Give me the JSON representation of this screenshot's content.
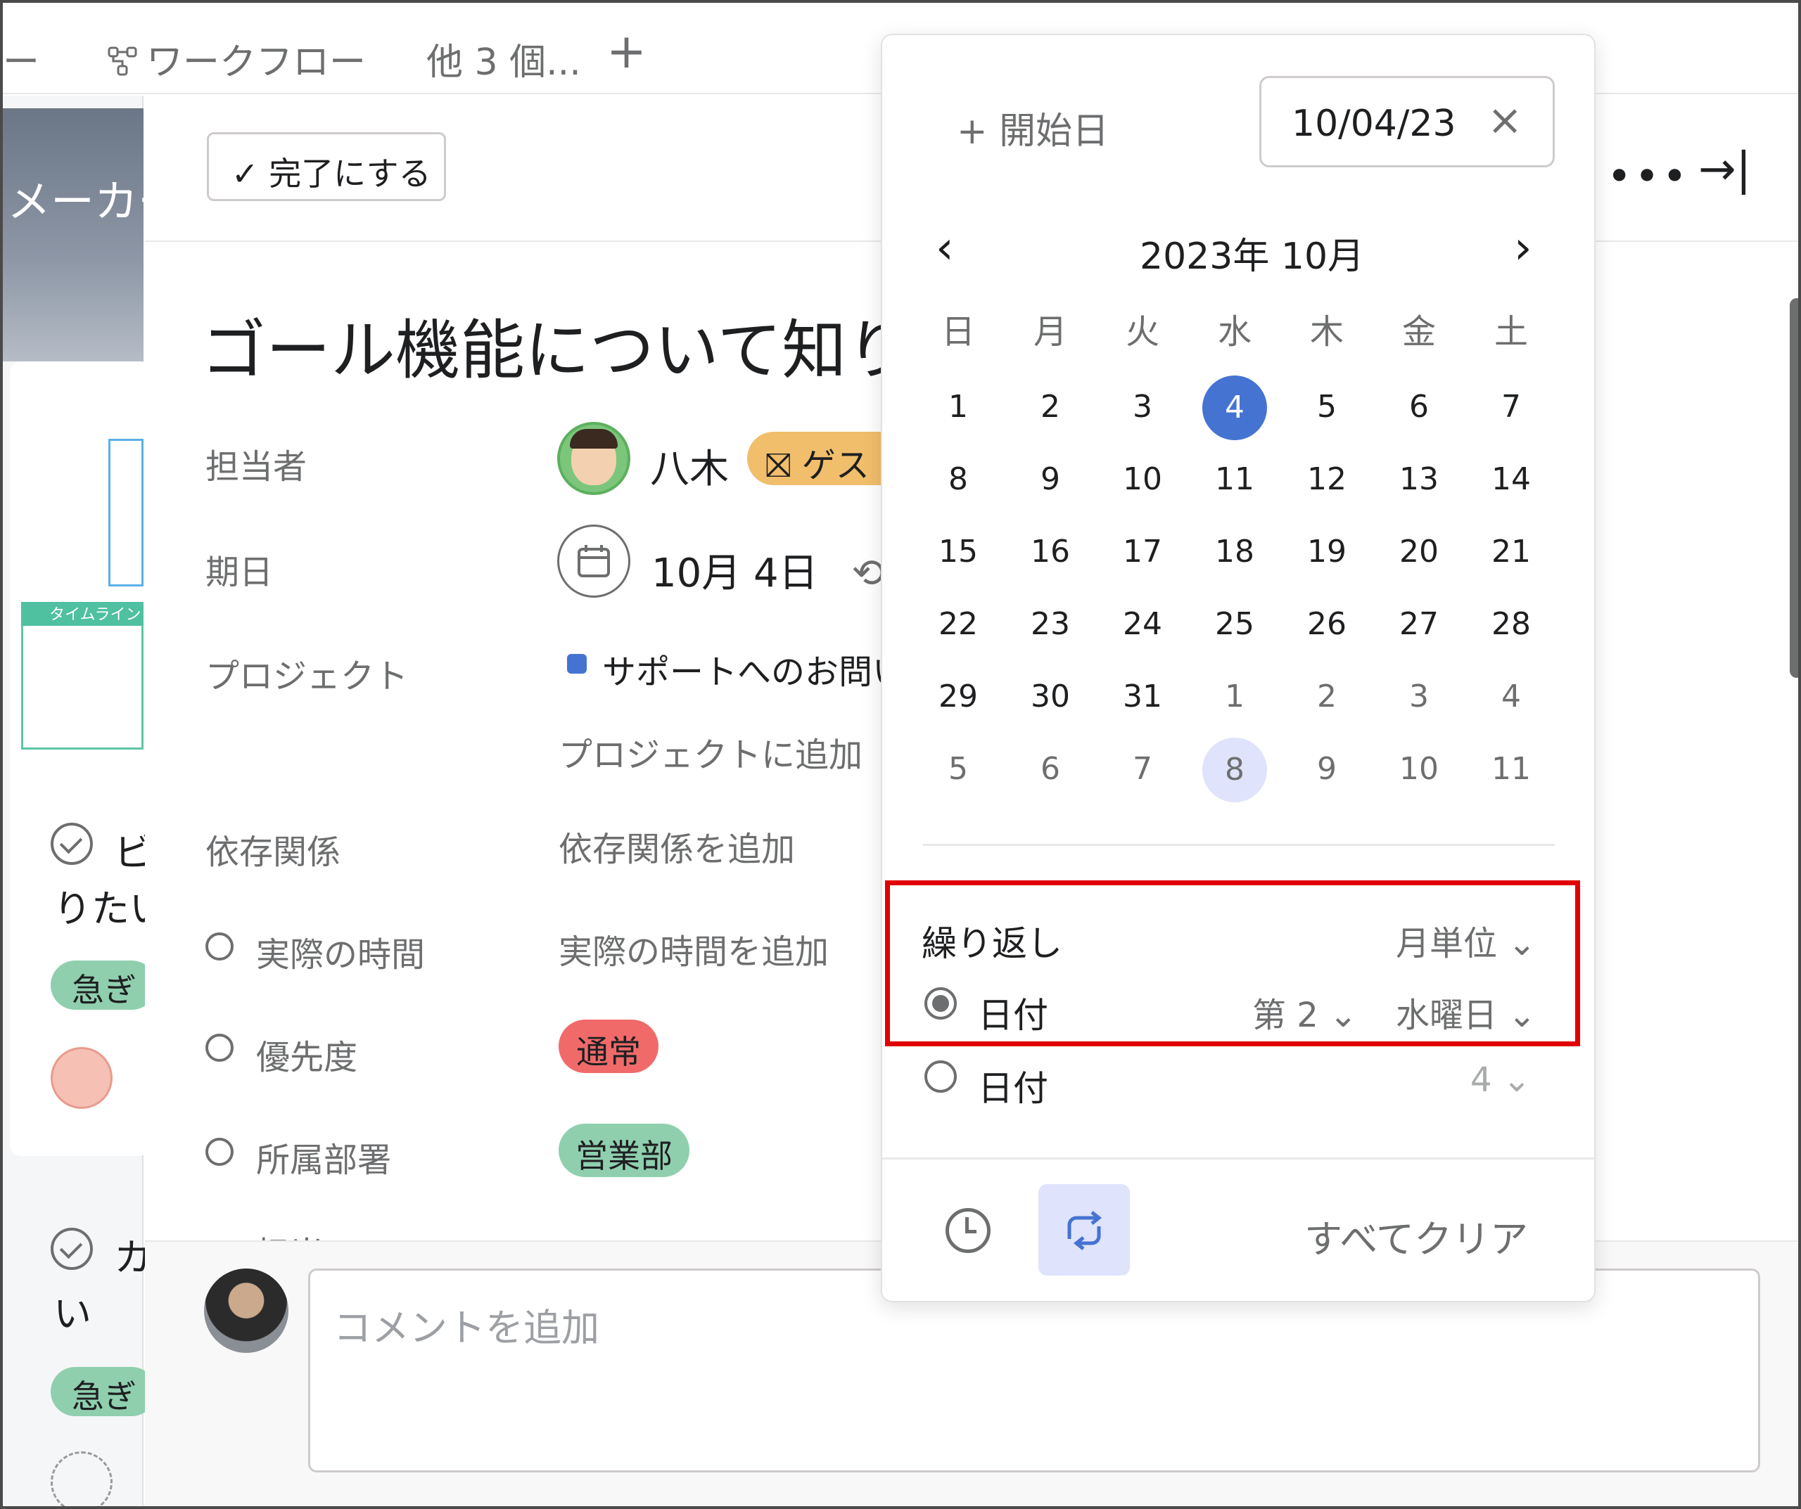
{
  "tabs": {
    "partial_left": "ー",
    "workflow": "ワークフロー",
    "more": "他 3 個...",
    "add": "+"
  },
  "left_board": {
    "banner_text": "メーカー",
    "thumb_header": "タイムライン",
    "card1_line1": "ビ",
    "card1_line2": "りたい",
    "card1_tag": "急ぎ",
    "card2_line1": "カ",
    "card2_line2": "い",
    "card2_tag": "急ぎ"
  },
  "task": {
    "complete_button": "完了にする",
    "title": "ゴール機能について知り",
    "fields": {
      "assignee_label": "担当者",
      "assignee_name": "八木",
      "guest_badge": "ゲス",
      "due_label": "期日",
      "due_value": "10月 4日",
      "project_label": "プロジェクト",
      "project_value": "サポートへのお問い",
      "add_to_project": "プロジェクトに追加",
      "dependency_label": "依存関係",
      "dependency_add": "依存関係を追加",
      "actual_time_label": "実際の時間",
      "actual_time_add": "実際の時間を追加",
      "priority_label": "優先度",
      "priority_value": "通常",
      "department_label": "所属部署",
      "department_value": "営業部",
      "partial_next_label": "担当"
    },
    "comment_placeholder": "コメントを追加",
    "more_icon": "•••",
    "collapse_icon": "→|"
  },
  "date_picker": {
    "start_date_button": "+ 開始日",
    "due_input_value": "10/04/23",
    "clear_icon": "×",
    "month_title": "2023年 10月",
    "prev": "‹",
    "next": "›",
    "weekdays": [
      "日",
      "月",
      "火",
      "水",
      "木",
      "金",
      "土"
    ],
    "weeks": [
      [
        "1",
        "2",
        "3",
        "4",
        "5",
        "6",
        "7"
      ],
      [
        "8",
        "9",
        "10",
        "11",
        "12",
        "13",
        "14"
      ],
      [
        "15",
        "16",
        "17",
        "18",
        "19",
        "20",
        "21"
      ],
      [
        "22",
        "23",
        "24",
        "25",
        "26",
        "27",
        "28"
      ],
      [
        "29",
        "30",
        "31",
        "1",
        "2",
        "3",
        "4"
      ],
      [
        "5",
        "6",
        "7",
        "8",
        "9",
        "10",
        "11"
      ]
    ],
    "selected_day": "4",
    "today_day": "8",
    "repeat": {
      "label": "繰り返し",
      "frequency": "月単位",
      "option1_label": "日付",
      "option1_week": "第 2",
      "option1_weekday": "水曜日",
      "option1_selected": true,
      "option2_label": "日付",
      "option2_day": "4",
      "option2_selected": false
    },
    "clear_all": "すべてクリア"
  },
  "colors": {
    "accent_blue": "#4573d2",
    "today_highlight": "#dfe3fb",
    "priority_red": "#f06a6a",
    "department_green": "#8fcfae",
    "guest_orange": "#f1be6b",
    "annotation_red": "#e00000"
  }
}
